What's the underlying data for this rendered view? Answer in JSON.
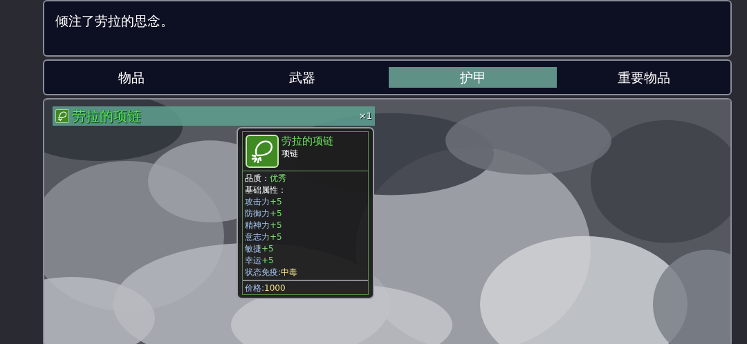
{
  "message": "倾注了劳拉的思念。",
  "tabs": [
    {
      "label": "物品",
      "selected": false
    },
    {
      "label": "武器",
      "selected": false
    },
    {
      "label": "护甲",
      "selected": true
    },
    {
      "label": "重要物品",
      "selected": false
    }
  ],
  "items": [
    {
      "name": "劳拉的项链",
      "count": "×1",
      "selected": true
    }
  ],
  "tooltip": {
    "name": "劳拉的项链",
    "type": "项链",
    "quality_label": "品质：",
    "quality": "优秀",
    "base_label": "基础属性：",
    "stats": [
      {
        "label": "攻击力",
        "value": "+5",
        "kind": "bonus"
      },
      {
        "label": "防御力",
        "value": "+5",
        "kind": "bonus"
      },
      {
        "label": "精神力",
        "value": "+5",
        "kind": "bonus"
      },
      {
        "label": "意志力",
        "value": "+5",
        "kind": "bonus"
      },
      {
        "label": "敏捷",
        "value": "+5",
        "kind": "bonus"
      },
      {
        "label": "幸运",
        "value": "+5",
        "kind": "bonus"
      },
      {
        "label": "状态免疫:",
        "value": "中毒",
        "kind": "status"
      }
    ],
    "price_label": "价格:",
    "price": "1000"
  }
}
